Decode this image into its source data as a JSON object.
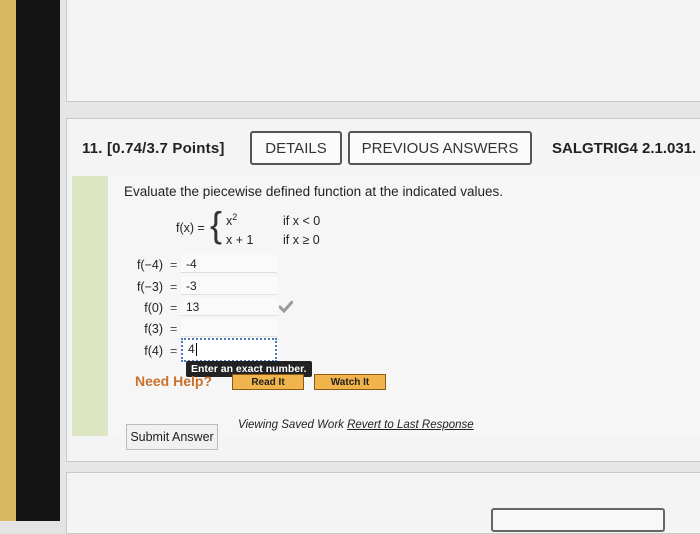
{
  "question": {
    "number_label": "11. [0.74/3.7 Points]",
    "details_label": "DETAILS",
    "previous_answers_label": "PREVIOUS ANSWERS",
    "code": "SALGTRIG4 2.1.031."
  },
  "problem": {
    "prompt": "Evaluate the piecewise defined function at the indicated values.",
    "function_label": "f(x) =",
    "brace": "{",
    "case1_expr": "x",
    "case1_exp": "2",
    "case1_cond": "if x < 0",
    "case2_expr": "x + 1",
    "case2_cond": "if x ≥ 0"
  },
  "answers": [
    {
      "label": "f(−4)",
      "eq": "=",
      "value": "-4"
    },
    {
      "label": "f(−3)",
      "eq": "=",
      "value": "-3"
    },
    {
      "label": "f(0)",
      "eq": "=",
      "value": "13"
    },
    {
      "label": "f(3)",
      "eq": "=",
      "value": ""
    },
    {
      "label": "f(4)",
      "eq": "=",
      "value": "4"
    }
  ],
  "tooltip": "Enter an exact number.",
  "help": {
    "need_help": "Need Help?",
    "read_it": "Read It",
    "watch_it": "Watch It"
  },
  "footer": {
    "submit": "Submit Answer",
    "viewing": "Viewing Saved Work",
    "revert": "Revert to Last Response"
  },
  "colors": {
    "accent_band": "#dde6c2",
    "help_orange": "#c9712a",
    "button_orange": "#f1b34b",
    "check_gray": "#9a9a9a"
  }
}
